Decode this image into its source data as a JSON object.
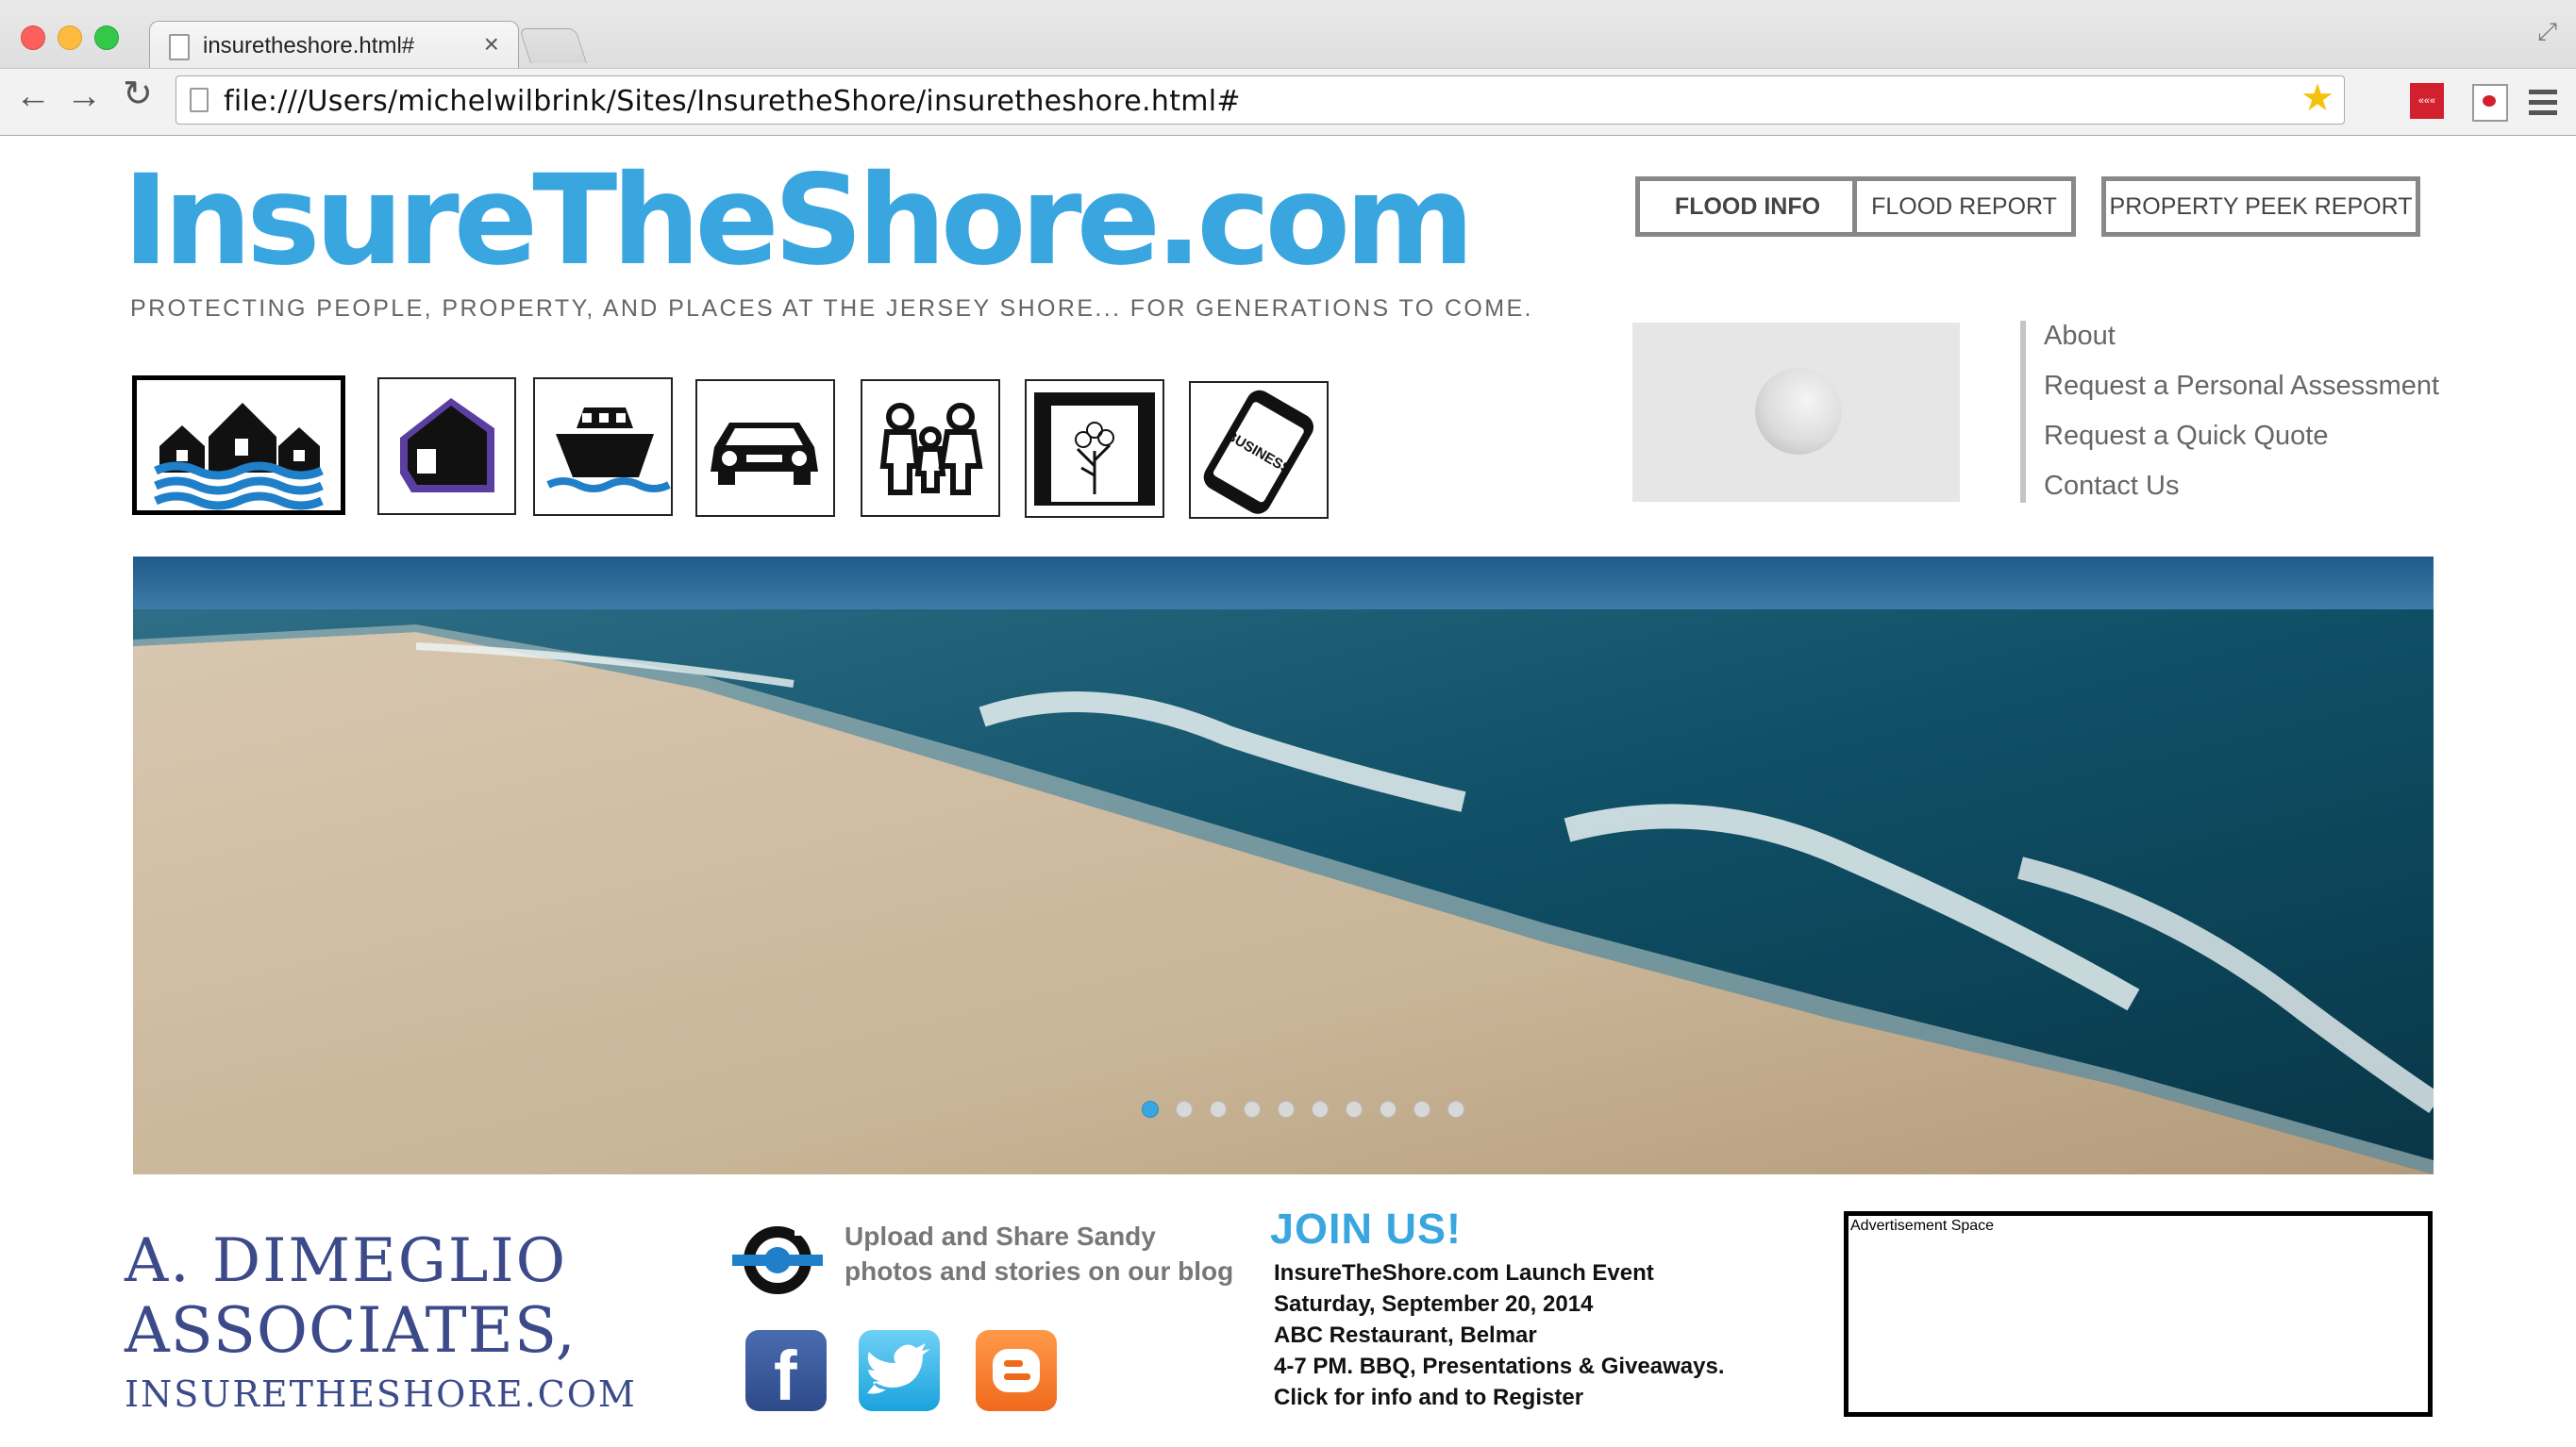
{
  "browser": {
    "tab_title": "insuretheshore.html#",
    "tab_close": "×",
    "url": "file:///Users/michelwilbrink/Sites/InsuretheShore/insuretheshore.html#",
    "back": "←",
    "forward": "→",
    "reload": "↻",
    "star": "★",
    "resize": "⤢"
  },
  "header": {
    "logo": "InsureTheShore.com",
    "tagline": "PROTECTING PEOPLE, PROPERTY, AND PLACES AT THE JERSEY SHORE... FOR GENERATIONS TO COME."
  },
  "top_buttons": {
    "flood_info": "FLOOD INFO",
    "flood_report": "FLOOD REPORT",
    "property_peek": "PROPERTY PEEK REPORT"
  },
  "categories": [
    {
      "icon": "flood-houses-icon"
    },
    {
      "icon": "home-icon"
    },
    {
      "icon": "boat-icon"
    },
    {
      "icon": "car-icon"
    },
    {
      "icon": "family-icon"
    },
    {
      "icon": "tree-icon"
    },
    {
      "icon": "business-phone-icon",
      "text": "BUSINESS"
    }
  ],
  "side_menu": [
    "About",
    "Request a Personal Assessment",
    "Request a Quick Quote",
    "Contact Us"
  ],
  "hero": {
    "slide_count": 10,
    "active_slide": 1
  },
  "footer": {
    "adi_line1": "A. DIMEGLIO",
    "adi_line2": "ASSOCIATES,",
    "adi_line3": "INSURETHESHORE.COM",
    "blog_line1": "Upload and Share Sandy",
    "blog_line2": "photos and stories on our blog",
    "join_title": "JOIN US!",
    "event_lines": [
      "InsureTheShore.com Launch Event",
      "Saturday, September 20, 2014",
      "ABC Restaurant, Belmar",
      "4-7 PM.  BBQ, Presentations & Giveaways.",
      "Click for info and to Register"
    ],
    "ad_label": "Advertisement Space",
    "social": [
      "facebook-icon",
      "twitter-icon",
      "blogger-icon"
    ]
  },
  "colors": {
    "brand_blue": "#3aa6e0",
    "adi_navy": "#3c4a8a"
  }
}
